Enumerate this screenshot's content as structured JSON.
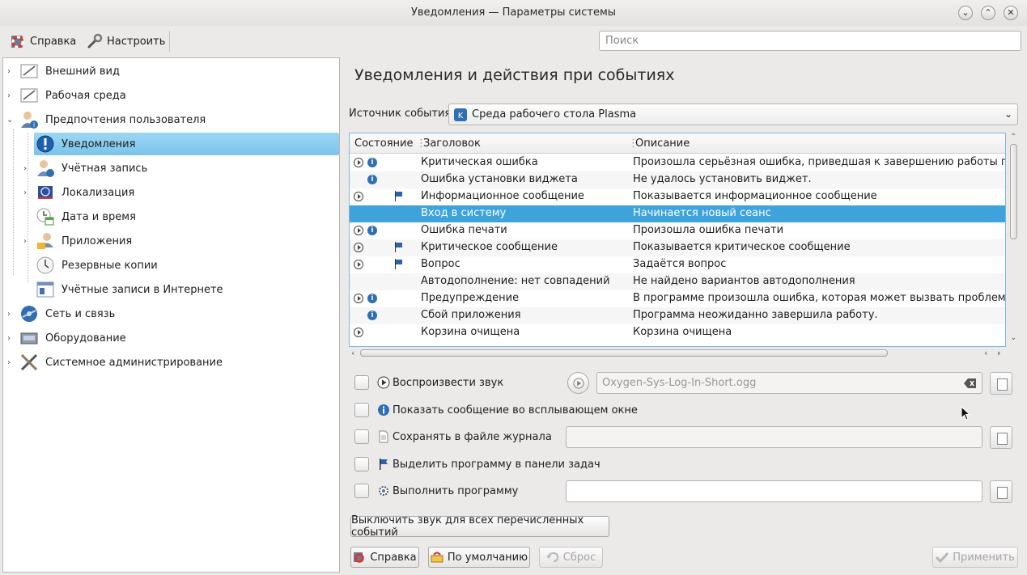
{
  "window": {
    "title": "Уведомления — Параметры системы"
  },
  "toolbar": {
    "help": "Справка",
    "configure": "Настроить",
    "search_placeholder": "Поиск"
  },
  "sidebar": {
    "items": [
      {
        "label": "Внешний вид"
      },
      {
        "label": "Рабочая среда"
      },
      {
        "label": "Предпочтения пользователя"
      },
      {
        "label": "Уведомления"
      },
      {
        "label": "Учётная запись"
      },
      {
        "label": "Локализация"
      },
      {
        "label": "Дата и время"
      },
      {
        "label": "Приложения"
      },
      {
        "label": "Резервные копии"
      },
      {
        "label": "Учётные записи в Интернете"
      },
      {
        "label": "Сеть и связь"
      },
      {
        "label": "Оборудование"
      },
      {
        "label": "Системное администрирование"
      }
    ]
  },
  "main": {
    "title": "Уведомления и действия при событиях",
    "source_label": "Источник события:",
    "source_value": "Среда рабочего стола Plasma",
    "columns": {
      "state": "Состояние",
      "title": "Заголовок",
      "description": "Описание"
    },
    "rows": [
      {
        "title": "Критическая ошибка",
        "description": "Произошла серьёзная ошибка, приведшая к завершению работы програм"
      },
      {
        "title": "Ошибка установки виджета",
        "description": "Не удалось установить виджет."
      },
      {
        "title": "Информационное сообщение",
        "description": "Показывается информационное сообщение"
      },
      {
        "title": "Вход в систему",
        "description": "Начинается новый сеанс"
      },
      {
        "title": "Ошибка печати",
        "description": "Произошла ошибка печати"
      },
      {
        "title": "Критическое сообщение",
        "description": "Показывается критическое сообщение"
      },
      {
        "title": "Вопрос",
        "description": "Задаётся вопрос"
      },
      {
        "title": "Автодополнение: нет совпадений",
        "description": "Не найдено вариантов автодополнения"
      },
      {
        "title": "Предупреждение",
        "description": "В программе произошла ошибка, которая может вызвать проблемы"
      },
      {
        "title": "Сбой приложения",
        "description": "Программа неожиданно завершила работу."
      },
      {
        "title": "Корзина очищена",
        "description": "Корзина очищена"
      }
    ],
    "options": {
      "play_sound": "Воспроизвести звук",
      "sound_file": "Oxygen-Sys-Log-In-Short.ogg",
      "popup": "Показать сообщение во всплывающем окне",
      "log_file": "Сохранять в файле журнала",
      "taskbar": "Выделить программу в панели задач",
      "run_program": "Выполнить программу"
    },
    "mute_all": "Выключить звук для всех перечисленных событий"
  },
  "buttons": {
    "help": "Справка",
    "defaults": "По умолчанию",
    "reset": "Сброс",
    "apply": "Применить"
  },
  "colors": {
    "selection": "#3fa3db",
    "sidebar_selection": "#8ccdef",
    "accent_blue": "#2e6fb6"
  }
}
